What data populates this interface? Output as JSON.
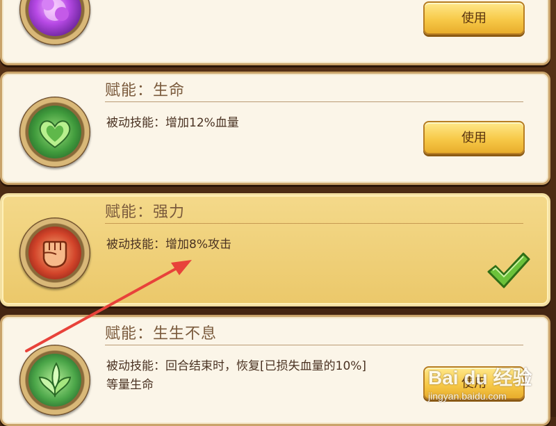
{
  "talents": [
    {
      "title": "",
      "desc": "",
      "button": "使用",
      "state": "use",
      "icon": "purple-burst-icon"
    },
    {
      "title": "赋能：生命",
      "desc": "被动技能：增加12%血量",
      "button": "使用",
      "state": "use",
      "icon": "green-heart-icon"
    },
    {
      "title": "赋能：强力",
      "desc": "被动技能：增加8%攻击",
      "button": "",
      "state": "selected",
      "icon": "red-fist-icon"
    },
    {
      "title": "赋能：生生不息",
      "desc_line1": "被动技能：回合结束时，恢复[已损失血量的10%]",
      "desc_line2": "等量生命",
      "button": "使用",
      "state": "use",
      "icon": "green-leaf-icon"
    }
  ],
  "watermark": {
    "logo_text": "Bai du 经验",
    "url_text": "jingyan.baidu.com"
  },
  "colors": {
    "accent": "#f7c948",
    "selected_bg": "#ebc86a",
    "card_bg": "#fbf5e8",
    "arrow": "#e8423a",
    "check": "#6cc23a"
  }
}
